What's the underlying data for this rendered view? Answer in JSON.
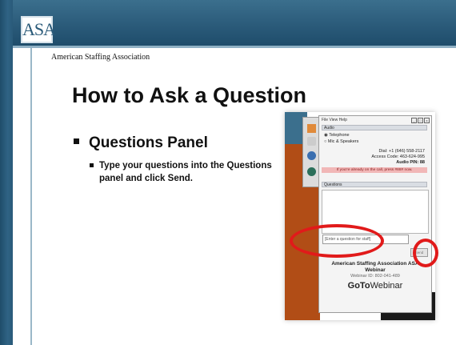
{
  "organization": "American Staffing Association",
  "logo_text": "ASA",
  "slide_title": "How to Ask a Question",
  "bullet_main": "Questions Panel",
  "bullet_sub": "Type your questions into the Questions panel and click Send.",
  "panel": {
    "menu": "File View Help",
    "window_buttons": [
      "_",
      "□",
      "x"
    ],
    "audio_section": "Audio",
    "audio_options": [
      "Telephone",
      "Mic & Speakers"
    ],
    "dial": "Dial: +1 (646) 558-2117",
    "access_code": "Access Code: 463-624-995",
    "audio_pin": "Audio PIN: 88",
    "notice": "If you're already on the call, press #88# now.",
    "questions_section": "Questions",
    "question_placeholder": "[Enter a question for staff]",
    "send_label": "Send",
    "webinar_title": "American Staffing Association ASA Webinar",
    "webinar_id": "Webinar ID: 802-041-489",
    "brand_go": "GoTo",
    "brand_webinar": "Webinar"
  },
  "colors": {
    "band": "#2a5a79",
    "highlight": "#e11a1a",
    "orange": "#b14d16"
  }
}
